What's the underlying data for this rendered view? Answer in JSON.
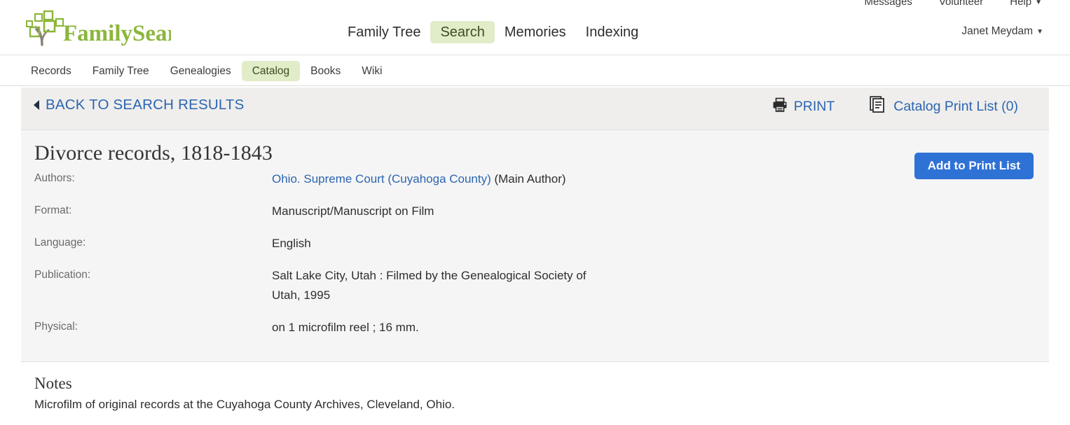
{
  "utility_bar": {
    "items": [
      {
        "label": "Messages",
        "caret": false
      },
      {
        "label": "Volunteer",
        "caret": false
      },
      {
        "label": "Help",
        "caret": true
      }
    ],
    "caret_glyph": "▼"
  },
  "brand": {
    "name": "FamilySearch",
    "word_family": "Family",
    "word_search": "Search",
    "green": "#8cb63c",
    "trunk_gray": "#8a8175"
  },
  "main_nav": {
    "items": [
      {
        "label": "Family Tree",
        "active": false
      },
      {
        "label": "Search",
        "active": true
      },
      {
        "label": "Memories",
        "active": false
      },
      {
        "label": "Indexing",
        "active": false
      }
    ],
    "active_bg": "#e1ecc8"
  },
  "account": {
    "name": "Janet Meydam",
    "caret_glyph": "▼"
  },
  "sub_nav": {
    "items": [
      {
        "label": "Records",
        "active": false
      },
      {
        "label": "Family Tree",
        "active": false
      },
      {
        "label": "Genealogies",
        "active": false
      },
      {
        "label": "Catalog",
        "active": true
      },
      {
        "label": "Books",
        "active": false
      },
      {
        "label": "Wiki",
        "active": false
      }
    ]
  },
  "action_bar": {
    "back_label": "BACK TO SEARCH RESULTS",
    "print_label": "PRINT",
    "print_list_label": "Catalog Print List (0)",
    "link_color": "#2c65b1",
    "bar_bg": "#efeeec"
  },
  "record": {
    "title": "Divorce records, 1818-1843",
    "add_button_label": "Add to Print List",
    "add_button_color": "#2f72d6",
    "fields": [
      {
        "label": "Authors:",
        "link_text": "Ohio. Supreme Court (Cuyahoga County)",
        "suffix": " (Main Author)"
      },
      {
        "label": "Format:",
        "value": "Manuscript/Manuscript on Film"
      },
      {
        "label": "Language:",
        "value": "English"
      },
      {
        "label": "Publication:",
        "value": "Salt Lake City, Utah : Filmed by the Genealogical Society of Utah, 1995"
      },
      {
        "label": "Physical:",
        "value": "on 1 microfilm reel ; 16 mm."
      }
    ]
  },
  "notes": {
    "heading": "Notes",
    "text": "Microfilm of original records at the Cuyahoga County Archives, Cleveland, Ohio."
  }
}
